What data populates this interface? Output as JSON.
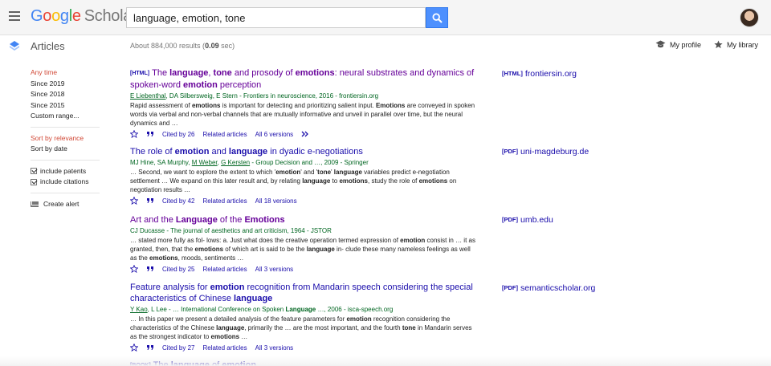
{
  "header": {
    "logo_google": "Google",
    "logo_scholar": "Scholar",
    "search_query": "language, emotion, tone",
    "logo_colors": [
      "#4285f4",
      "#ea4335",
      "#fbbc05",
      "#4285f4",
      "#34a853",
      "#ea4335"
    ]
  },
  "subbar": {
    "section_label": "Articles",
    "results_prefix": "About 884,000 results (",
    "results_time": "0.09",
    "results_suffix": " sec)",
    "my_profile": "My profile",
    "my_library": "My library"
  },
  "sidebar": {
    "time_filters": [
      "Any time",
      "Since 2019",
      "Since 2018",
      "Since 2015",
      "Custom range..."
    ],
    "sort_options": [
      "Sort by relevance",
      "Sort by date"
    ],
    "checkboxes": [
      "include patents",
      "include citations"
    ],
    "create_alert": "Create alert"
  },
  "results": [
    {
      "tag": "[HTML]",
      "title_parts": [
        "The ",
        "language",
        ", ",
        "tone",
        " and prosody of ",
        "emotions",
        ": neural substrates and dynamics of spoken-word ",
        "emotion",
        " perception"
      ],
      "authors_linked": "E Liebenthal",
      "authors_rest": ", DA Silbersweig, E Stern - Frontiers in neuroscience, 2016 - frontiersin.org",
      "snippet": [
        "Rapid assessment of ",
        "emotions",
        " is important for detecting and prioritizing salient input. ",
        "Emotions",
        " are conveyed in spoken words via verbal and non-verbal channels that are mutually informative and unveil in parallel over time, but the neural dynamics and …"
      ],
      "cited_by": "Cited by 26",
      "related": "Related articles",
      "versions": "All 6 versions",
      "side_tag": "[HTML]",
      "side_domain": "frontiersin.org"
    },
    {
      "tag": "",
      "title_parts": [
        "The role of ",
        "emotion",
        " and ",
        "language",
        " in dyadic e-negotiations"
      ],
      "authors_linked": "",
      "authors_pre": "MJ Hine, SA Murphy, ",
      "authors_link1": "M Weber",
      "authors_mid": ", ",
      "authors_link2": "G Kersten",
      "authors_rest": " - Group Decision and …, 2009 - Springer",
      "snippet": [
        "… Second, we want to explore the extent to which '",
        "emotion",
        "' and '",
        "tone",
        "' ",
        "language",
        " variables predict e-negotiation settlement … We expand on this later result and, by relating ",
        "language",
        " to ",
        "emotions",
        ", study the role of ",
        "emotions",
        " on negotiation results …"
      ],
      "cited_by": "Cited by 42",
      "related": "Related articles",
      "versions": "All 18 versions",
      "side_tag": "[PDF]",
      "side_domain": "uni-magdeburg.de"
    },
    {
      "tag": "",
      "title_parts": [
        "Art and the ",
        "Language",
        " of the ",
        "Emotions",
        ""
      ],
      "authors_rest": "CJ Ducasse - The journal of aesthetics and art criticism, 1964 - JSTOR",
      "snippet": [
        "… stated more fully as fol- lows: a. Just what does the creative operation termed expression of ",
        "emotion",
        " consist in … it as granted, then, that the ",
        "emotions",
        " of which art is said to be the ",
        "language",
        " in- clude these many nameless feelings as well as the ",
        "emotions",
        ", moods, sentiments …"
      ],
      "cited_by": "Cited by 25",
      "related": "Related articles",
      "versions": "All 3 versions",
      "side_tag": "[PDF]",
      "side_domain": "umb.edu"
    },
    {
      "tag": "",
      "title_parts": [
        "Feature analysis for ",
        "emotion",
        " recognition from Mandarin speech considering the special characteristics of Chinese ",
        "language",
        ""
      ],
      "authors_linked": "Y Kao",
      "authors_pre2": ", L Lee - … International Conference on Spoken ",
      "authors_bold": "Language",
      "authors_rest": " …, 2006 - isca-speech.org",
      "snippet": [
        "… In this paper we present a detailed analysis of the feature parameters for ",
        "emotion",
        " recognition considering the characteristics of the Chinese ",
        "language",
        ", primarily the … are the most important, and the fourth ",
        "tone",
        " in Mandarin serves as the strongest indicator to ",
        "emotions",
        " …"
      ],
      "cited_by": "Cited by 27",
      "related": "Related articles",
      "versions": "All 3 versions",
      "side_tag": "[PDF]",
      "side_domain": "semanticscholar.org"
    }
  ],
  "partial_result": {
    "tag": "[BOOK]",
    "title_parts": [
      "The ",
      "language",
      " of ",
      "emotion"
    ]
  }
}
